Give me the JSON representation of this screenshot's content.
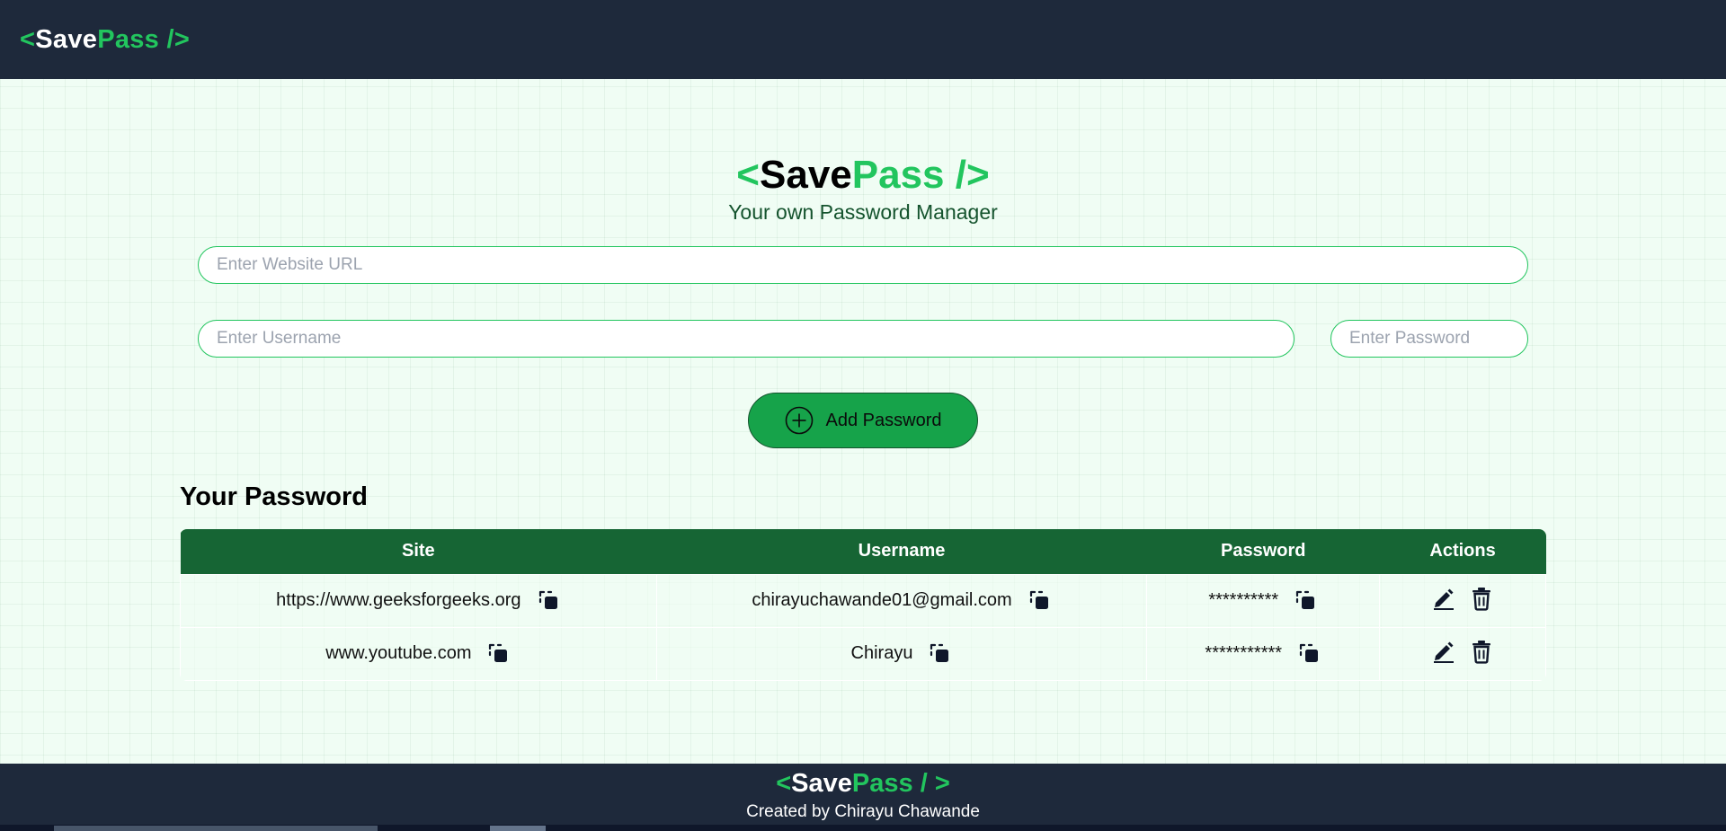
{
  "navbar": {
    "logo": {
      "open": "<",
      "save": "Save",
      "pass": "Pass",
      "close": "/>"
    }
  },
  "hero": {
    "logo": {
      "open": "<",
      "save": "Save",
      "pass": "Pass",
      "close": "/>"
    },
    "subtitle": "Your own Password Manager"
  },
  "form": {
    "url_placeholder": "Enter Website URL",
    "url_value": "",
    "username_placeholder": "Enter Username",
    "username_value": "",
    "password_placeholder": "Enter Password",
    "password_value": "",
    "add_button_label": "Add Password",
    "add_button_icon": "plus-circle-icon"
  },
  "passwords": {
    "title": "Your Password",
    "columns": [
      "Site",
      "Username",
      "Password",
      "Actions"
    ],
    "rows": [
      {
        "site": "https://www.geeksforgeeks.org",
        "username": "chirayuchawande01@gmail.com",
        "password": "**********"
      },
      {
        "site": "www.youtube.com",
        "username": "Chirayu",
        "password": "***********"
      }
    ],
    "action_icons": [
      "edit-icon",
      "delete-icon"
    ]
  },
  "footer": {
    "logo": {
      "open": "<",
      "save": "Save",
      "pass": "Pass",
      "close": "/ >"
    },
    "credit": "Created by Chirayu Chawande"
  },
  "colors": {
    "nav_bg": "#1e293b",
    "accent_green": "#22c55e",
    "button_green": "#16a34a",
    "table_header": "#166534",
    "page_bg": "#f0fdf4"
  }
}
